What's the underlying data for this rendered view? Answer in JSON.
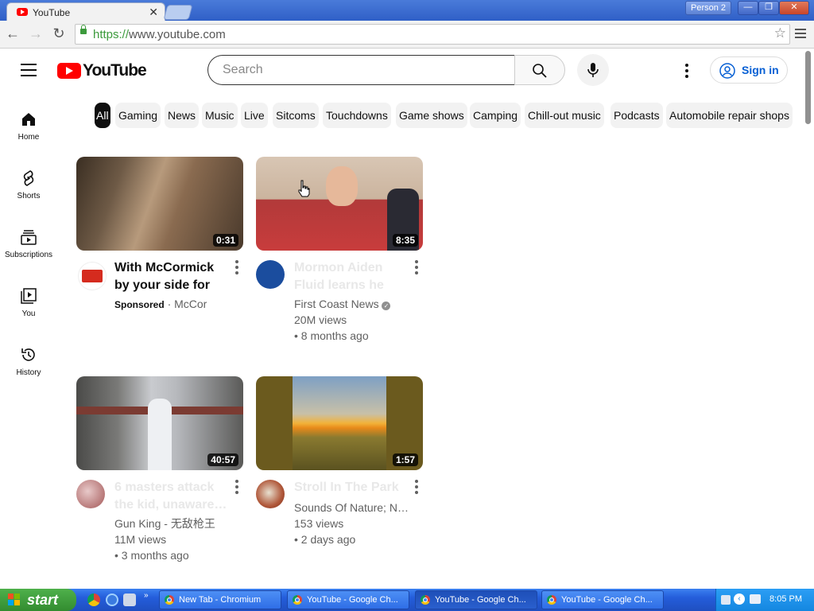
{
  "browser": {
    "tab_title": "YouTube",
    "tab_close": "✕",
    "profile": "Person 2",
    "window_buttons": [
      "—",
      "❐",
      "✕"
    ],
    "url_scheme": "https://",
    "url_rest": "www.youtube.com"
  },
  "masthead": {
    "logo_text": "YouTube",
    "search_placeholder": "Search",
    "signin_label": "Sign in"
  },
  "sidebar": {
    "items": [
      {
        "label": "Home",
        "icon": "home-icon"
      },
      {
        "label": "Shorts",
        "icon": "shorts-icon"
      },
      {
        "label": "Subscriptions",
        "icon": "subscriptions-icon"
      },
      {
        "label": "You",
        "icon": "you-icon"
      },
      {
        "label": "History",
        "icon": "history-icon"
      }
    ]
  },
  "chips": [
    "All",
    "Gaming",
    "News",
    "Music",
    "Live",
    "Sitcoms",
    "Touchdowns",
    "Game shows",
    "Camping",
    "Chill-out music",
    "Podcasts",
    "Automobile repair shops"
  ],
  "videos": [
    {
      "duration": "0:31",
      "title": "With McCormick by your side for over…",
      "sponsored": "Sponsored",
      "channel": "McCor"
    },
    {
      "duration": "8:35",
      "title": "Mormon Aiden Fluid learns he w…",
      "channel": "First Coast News",
      "views": "20M views",
      "age": "• 8 months ago"
    },
    {
      "duration": "40:57",
      "title": "6 masters attack the kid, unaware…",
      "channel": "Gun King - 无敌枪王",
      "views": "11M views",
      "age": "• 3 months ago"
    },
    {
      "duration": "1:57",
      "title": "Stroll In The Park",
      "channel": "Sounds Of Nature; N…",
      "views": "153 views",
      "age": "• 2 days ago"
    }
  ],
  "taskbar": {
    "start": "start",
    "tasks": [
      "New Tab - Chromium",
      "YouTube - Google Ch...",
      "YouTube - Google Ch...",
      "YouTube - Google Ch..."
    ],
    "clock": "8:05 PM"
  },
  "colors": {
    "accent": "#ff0000",
    "signin": "#065fd4",
    "taskbar": "#245ddb"
  }
}
